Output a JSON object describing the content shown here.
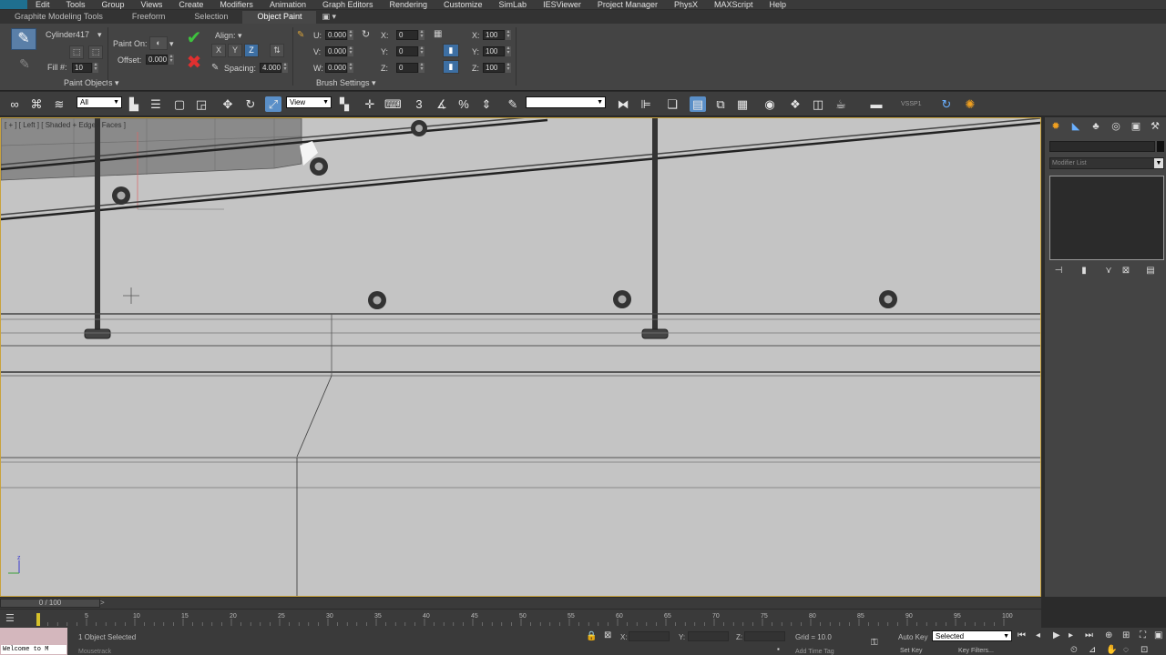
{
  "menu": [
    "Edit",
    "Tools",
    "Group",
    "Views",
    "Create",
    "Modifiers",
    "Animation",
    "Graph Editors",
    "Rendering",
    "Customize",
    "SimLab",
    "IESViewer",
    "Project Manager",
    "PhysX",
    "MAXScript",
    "Help"
  ],
  "ribbon_tabs": [
    "Graphite Modeling Tools",
    "Freeform",
    "Selection",
    "Object Paint"
  ],
  "ribbon_tab_toggle": "▣ ▾",
  "paint_objects": {
    "object_name": "Cylinder417",
    "fill_label": "Fill #:",
    "fill_value": "10",
    "panel_title": "Paint Objects ▾"
  },
  "brush": {
    "paint_on_label": "Paint On:",
    "offset_label": "Offset:",
    "offset_value": "0.000",
    "align_label": "Align: ▾",
    "axis_x": "X",
    "axis_y": "Y",
    "axis_z": "Z",
    "spacing_label": "Spacing:",
    "spacing_value": "4.000",
    "u_label": "U:",
    "u_value": "0.000",
    "v_label": "V:",
    "v_value": "0.000",
    "w_label": "W:",
    "w_value": "0.000",
    "rx_label": "X:",
    "rx_value": "0",
    "ry_label": "Y:",
    "ry_value": "0",
    "rz_label": "Z:",
    "rz_value": "0",
    "sx_label": "X:",
    "sx_value": "100",
    "sy_label": "Y:",
    "sy_value": "100",
    "sz_label": "Z:",
    "sz_value": "100",
    "panel_title": "Brush Settings ▾"
  },
  "main_toolbar": {
    "filter_value": "All",
    "refcoord_value": "View",
    "named_selection_value": "",
    "render_preset": "VSSP1"
  },
  "viewport": {
    "label": "[ + ] [ Left ] [ Shaded + Edged Faces ]",
    "background": "#c4c4c4",
    "active_border": "#c9a23c",
    "axis_label": "z"
  },
  "command_panel": {
    "modifier_list": "Modifier List"
  },
  "timeline": {
    "slider_label": "0 / 100",
    "slider_arrow": ">",
    "ticks": [
      "5",
      "10",
      "15",
      "20",
      "25",
      "30",
      "35",
      "40",
      "45",
      "50",
      "55",
      "60",
      "65",
      "70",
      "75",
      "80",
      "85",
      "90",
      "95",
      "100"
    ]
  },
  "status": {
    "maxscript_text": "Welcome to M",
    "selection_status": "1 Object Selected",
    "prompt_text": "Mousetrack",
    "x_label": "X:",
    "y_label": "Y:",
    "z_label": "Z:",
    "grid": "Grid = 10.0",
    "add_time_tag": "Add Time Tag",
    "auto_key": "Auto Key",
    "set_key": "Set Key",
    "key_filters": "Key Filters...",
    "selected_value": "Selected"
  }
}
